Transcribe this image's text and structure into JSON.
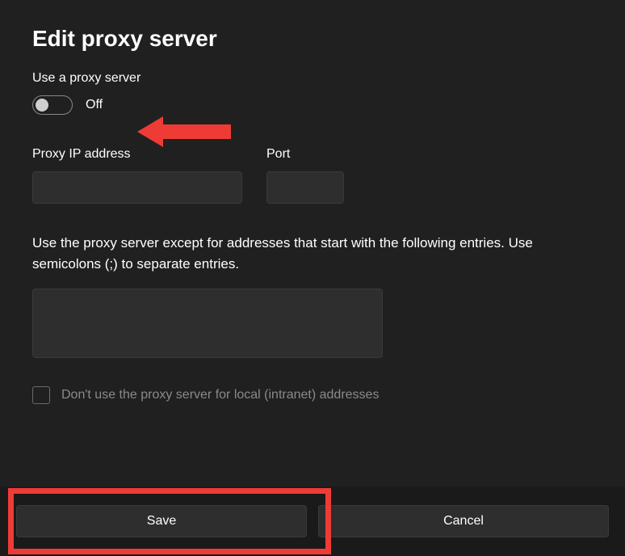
{
  "title": "Edit proxy server",
  "toggle": {
    "label": "Use a proxy server",
    "state": "Off"
  },
  "ip_field": {
    "label": "Proxy IP address",
    "value": ""
  },
  "port_field": {
    "label": "Port",
    "value": ""
  },
  "exceptions": {
    "description": "Use the proxy server except for addresses that start with the following entries. Use semicolons (;) to separate entries.",
    "value": ""
  },
  "local_checkbox": {
    "label": "Don't use the proxy server for local (intranet) addresses",
    "checked": false
  },
  "buttons": {
    "save": "Save",
    "cancel": "Cancel"
  }
}
